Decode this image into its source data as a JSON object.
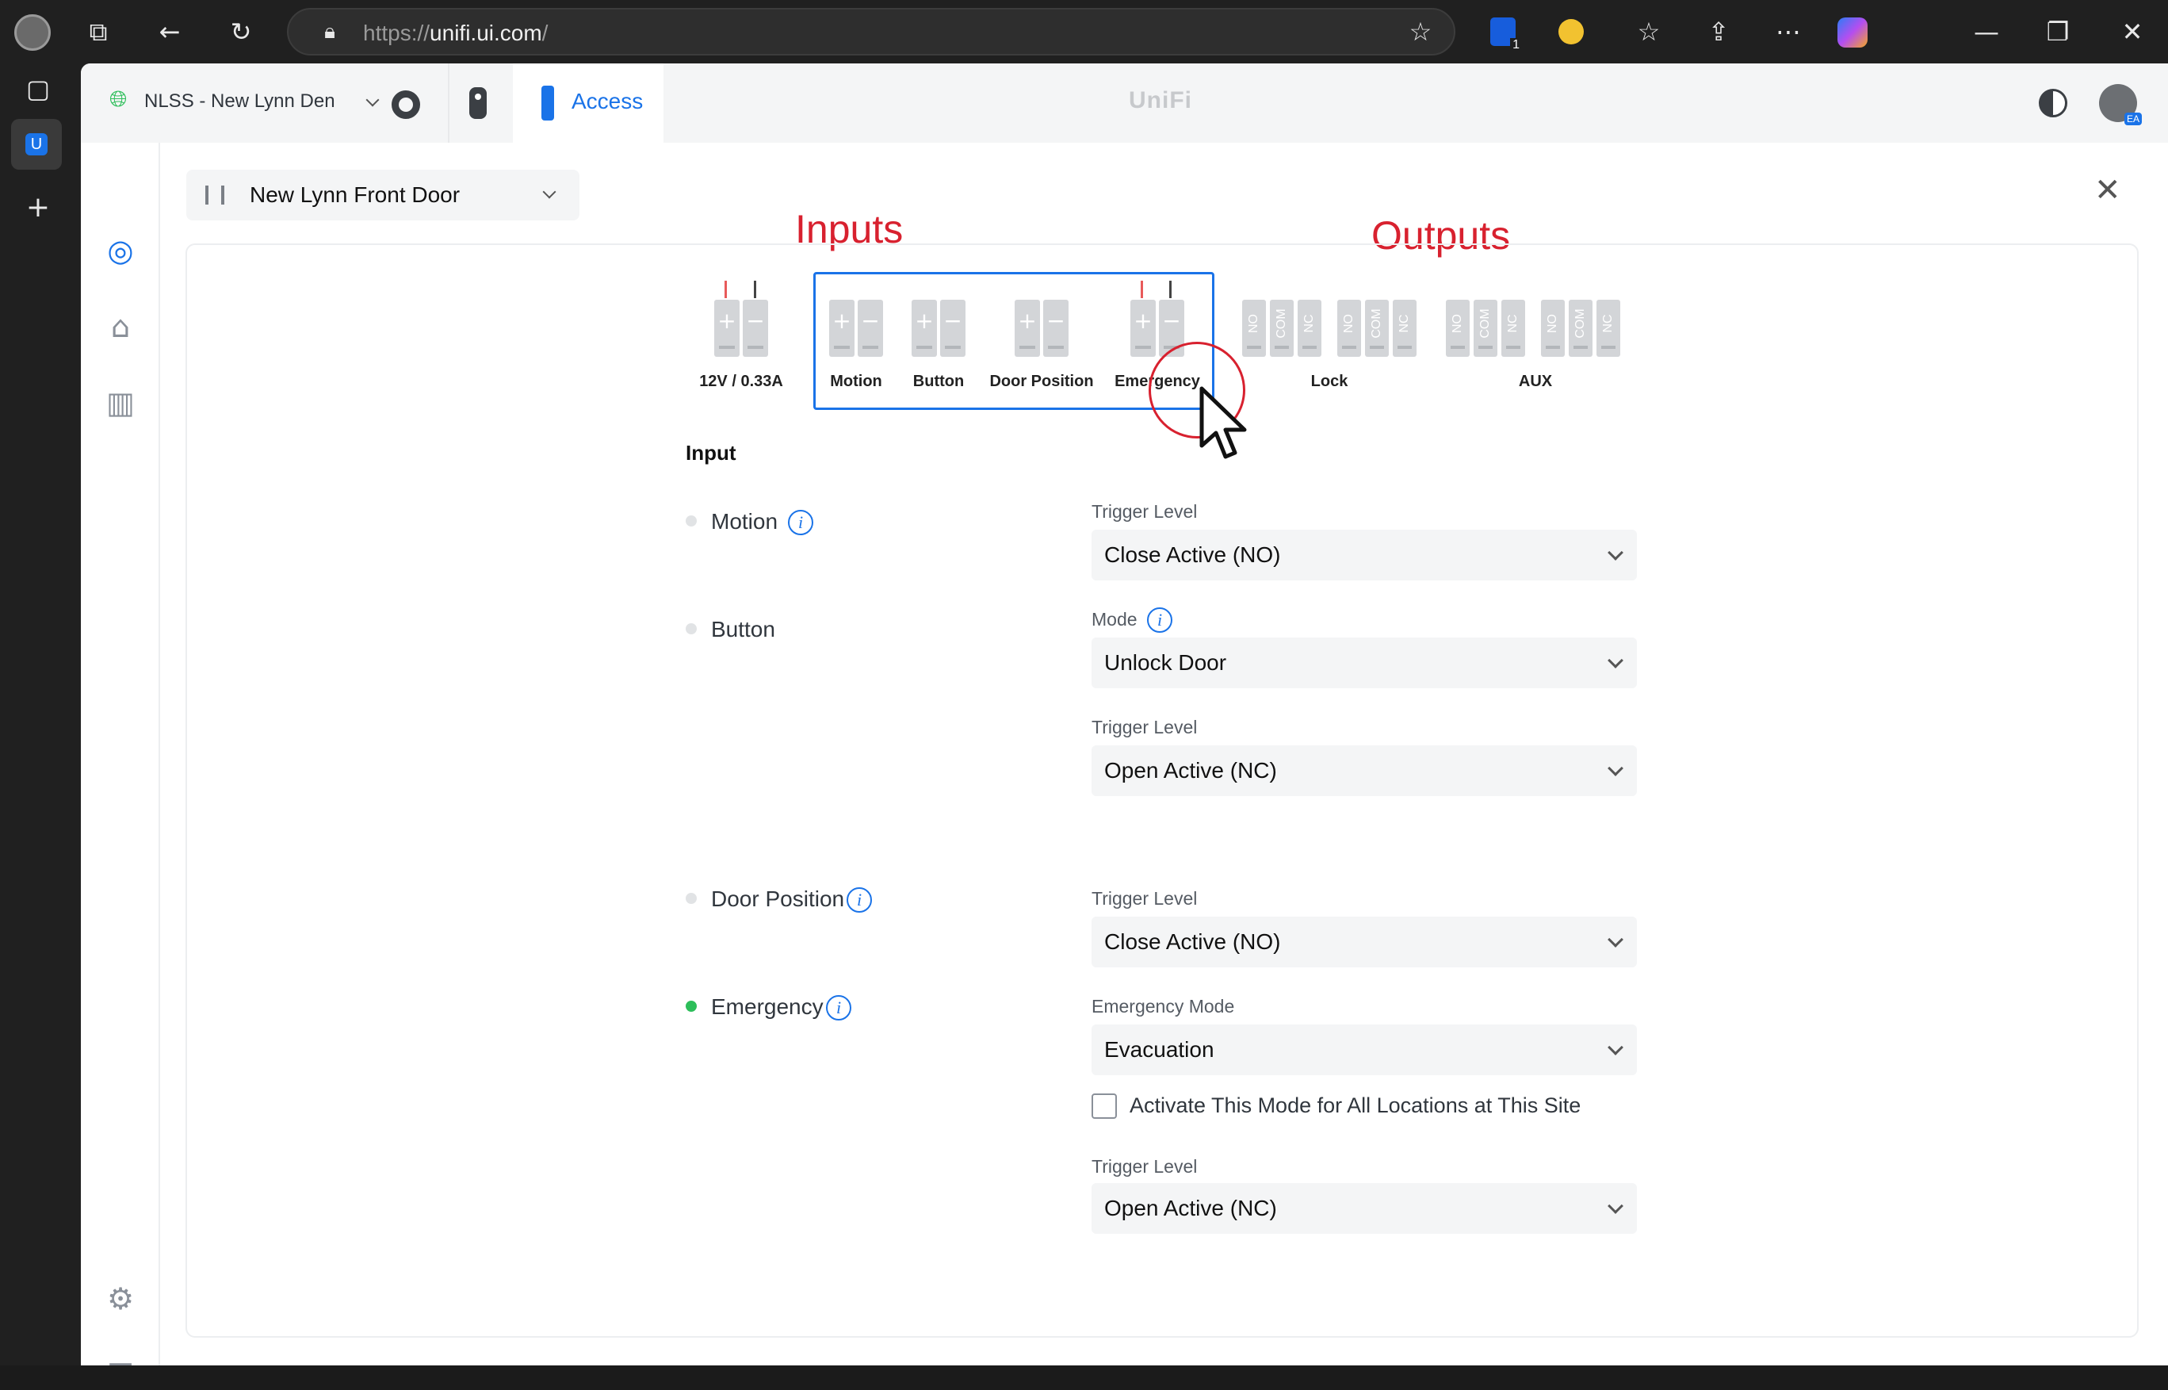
{
  "browser": {
    "url_prefix": "https://",
    "url_host": "unifi.ui.com",
    "url_suffix": "/",
    "extension_badge": "1"
  },
  "app": {
    "site_name": "NLSS - New Lynn Den",
    "active_tab": "Access",
    "logo": "UniFi",
    "avatar_badge": "EA"
  },
  "door": {
    "name": "New Lynn Front Door"
  },
  "annotations": {
    "inputs": "Inputs",
    "outputs": "Outputs"
  },
  "connectors": {
    "power": "12V / 0.33A",
    "inputs": [
      "Motion",
      "Button",
      "Door Position",
      "Emergency"
    ],
    "lock": "Lock",
    "aux": "AUX",
    "output_terminals": [
      "NO",
      "COM",
      "NC"
    ]
  },
  "form": {
    "section_title": "Input",
    "motion": {
      "label": "Motion",
      "trigger_label": "Trigger Level",
      "trigger_value": "Close Active (NO)"
    },
    "button": {
      "label": "Button",
      "mode_label": "Mode",
      "mode_value": "Unlock Door",
      "trigger_label": "Trigger Level",
      "trigger_value": "Open Active (NC)"
    },
    "door_position": {
      "label": "Door Position",
      "trigger_label": "Trigger Level",
      "trigger_value": "Close Active (NO)"
    },
    "emergency": {
      "label": "Emergency",
      "mode_label": "Emergency Mode",
      "mode_value": "Evacuation",
      "checkbox_label": "Activate This Mode for All Locations at This Site",
      "checkbox_checked": false,
      "trigger_label": "Trigger Level",
      "trigger_value": "Open Active (NC)",
      "status_color": "#2dbe5a"
    }
  },
  "colors": {
    "accent": "#1a73e8",
    "annotation": "#d8212f"
  }
}
